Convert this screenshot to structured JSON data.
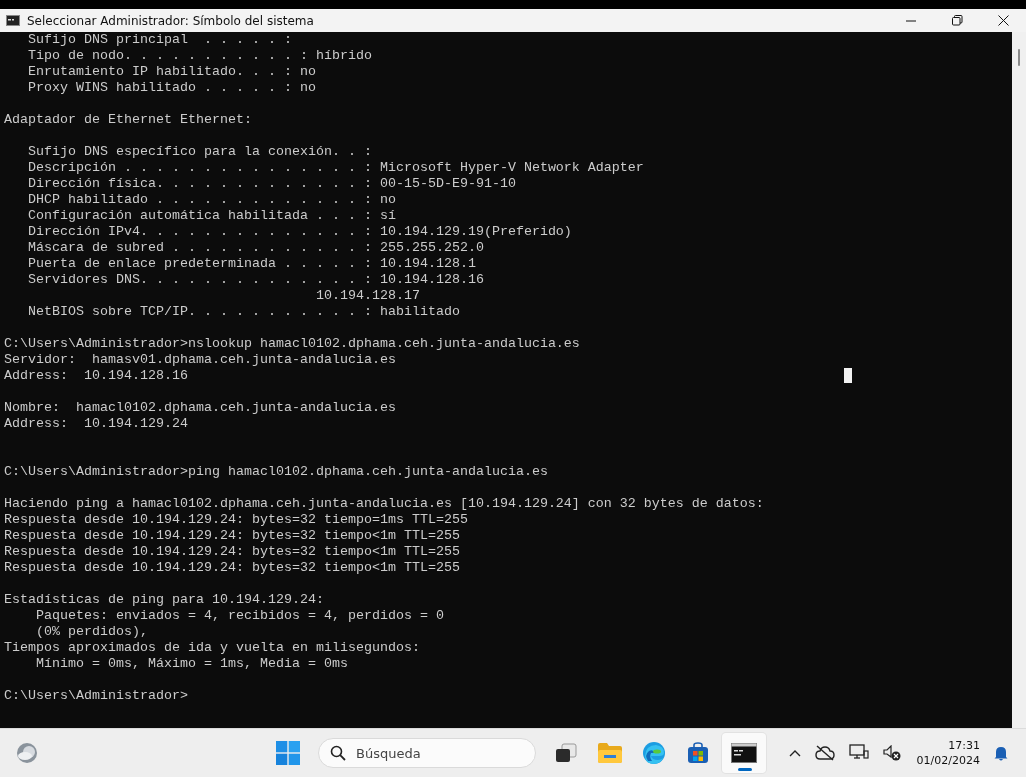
{
  "window": {
    "title": "Seleccionar Administrador: Símbolo del sistema"
  },
  "console": {
    "lines": [
      {
        "kind": "text",
        "text": "   Sufijo DNS principal  . . . . . :"
      },
      {
        "kind": "text",
        "text": "   Tipo de nodo. . . . . . . . . . . : híbrido"
      },
      {
        "kind": "text",
        "text": "   Enrutamiento IP habilitado. . . : no"
      },
      {
        "kind": "text",
        "text": "   Proxy WINS habilitado . . . . . : no"
      },
      {
        "kind": "blank"
      },
      {
        "kind": "text",
        "text": "Adaptador de Ethernet Ethernet:"
      },
      {
        "kind": "blank"
      },
      {
        "kind": "text",
        "text": "   Sufijo DNS específico para la conexión. . :"
      },
      {
        "kind": "text",
        "text": "   Descripción . . . . . . . . . . . . . . . : Microsoft Hyper-V Network Adapter"
      },
      {
        "kind": "text",
        "text": "   Dirección física. . . . . . . . . . . . . : 00-15-5D-E9-91-10"
      },
      {
        "kind": "text",
        "text": "   DHCP habilitado . . . . . . . . . . . . . : no"
      },
      {
        "kind": "text",
        "text": "   Configuración automática habilitada . . . : sí"
      },
      {
        "kind": "text",
        "text": "   Dirección IPv4. . . . . . . . . . . . . . : 10.194.129.19(Preferido)"
      },
      {
        "kind": "text",
        "text": "   Máscara de subred . . . . . . . . . . . . : 255.255.252.0"
      },
      {
        "kind": "text",
        "text": "   Puerta de enlace predeterminada . . . . . : 10.194.128.1"
      },
      {
        "kind": "text",
        "text": "   Servidores DNS. . . . . . . . . . . . . . : 10.194.128.16"
      },
      {
        "kind": "text",
        "text": "                                       10.194.128.17"
      },
      {
        "kind": "text",
        "text": "   NetBIOS sobre TCP/IP. . . . . . . . . . . : habilitado"
      },
      {
        "kind": "blank"
      },
      {
        "kind": "text",
        "text": "C:\\Users\\Administrador>nslookup hamacl0102.dphama.ceh.junta-andalucia.es"
      },
      {
        "kind": "text",
        "text": "Servidor:  hamasv01.dphama.ceh.junta-andalucia.es"
      },
      {
        "kind": "text",
        "text": "Address:  10.194.128.16"
      },
      {
        "kind": "blank"
      },
      {
        "kind": "text",
        "text": "Nombre:  hamacl0102.dphama.ceh.junta-andalucia.es"
      },
      {
        "kind": "text",
        "text": "Address:  10.194.129.24"
      },
      {
        "kind": "blank"
      },
      {
        "kind": "blank"
      },
      {
        "kind": "text",
        "text": "C:\\Users\\Administrador>ping hamacl0102.dphama.ceh.junta-andalucia.es"
      },
      {
        "kind": "blank"
      },
      {
        "kind": "text",
        "text": "Haciendo ping a hamacl0102.dphama.ceh.junta-andalucia.es [10.194.129.24] con 32 bytes de datos:"
      },
      {
        "kind": "text",
        "text": "Respuesta desde 10.194.129.24: bytes=32 tiempo=1ms TTL=255"
      },
      {
        "kind": "text",
        "text": "Respuesta desde 10.194.129.24: bytes=32 tiempo<1m TTL=255"
      },
      {
        "kind": "text",
        "text": "Respuesta desde 10.194.129.24: bytes=32 tiempo<1m TTL=255"
      },
      {
        "kind": "text",
        "text": "Respuesta desde 10.194.129.24: bytes=32 tiempo<1m TTL=255"
      },
      {
        "kind": "blank"
      },
      {
        "kind": "text",
        "text": "Estadísticas de ping para 10.194.129.24:"
      },
      {
        "kind": "text",
        "text": "    Paquetes: enviados = 4, recibidos = 4, perdidos = 0"
      },
      {
        "kind": "text",
        "text": "    (0% perdidos),"
      },
      {
        "kind": "text",
        "text": "Tiempos aproximados de ida y vuelta en milisegundos:"
      },
      {
        "kind": "text",
        "text": "    Mínimo = 0ms, Máximo = 1ms, Media = 0ms"
      },
      {
        "kind": "blank"
      },
      {
        "kind": "text",
        "text": "C:\\Users\\Administrador>"
      }
    ]
  },
  "taskbar": {
    "search": {
      "placeholder": "Búsqueda"
    },
    "apps": [
      {
        "kind": "task-view",
        "selected": false
      },
      {
        "kind": "explorer",
        "selected": false
      },
      {
        "kind": "edge",
        "selected": false
      },
      {
        "kind": "store",
        "selected": false
      },
      {
        "kind": "terminal",
        "selected": true
      }
    ],
    "clock": {
      "time": "17:31",
      "date": "01/02/2024"
    }
  }
}
